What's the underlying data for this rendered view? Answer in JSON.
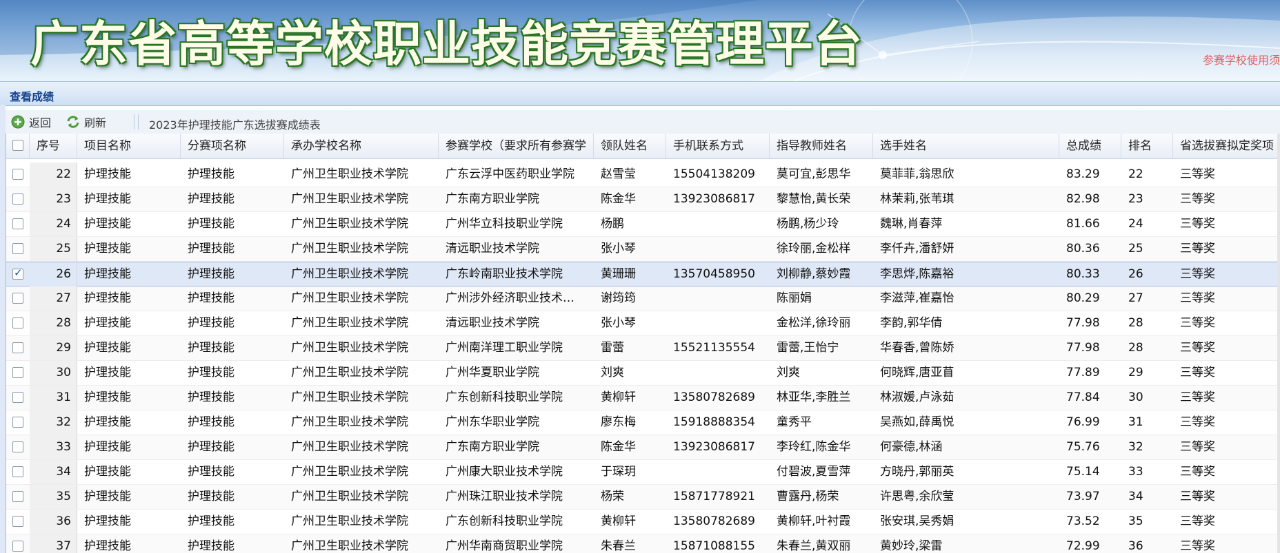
{
  "banner": {
    "title": "广东省高等学校职业技能竞赛管理平台",
    "note": "参赛学校使用须"
  },
  "panel": {
    "title": "查看成绩"
  },
  "toolbar": {
    "back_label": "返回",
    "refresh_label": "刷新",
    "sheet_title": "2023年护理技能广东选拔赛成绩表",
    "icons": {
      "back": "add-circle-icon",
      "refresh": "refresh-icon"
    }
  },
  "columns": [
    "序号",
    "项目名称",
    "分赛项名称",
    "承办学校名称",
    "参赛学校（要求所有参赛学",
    "领队姓名",
    "手机联系方式",
    "指导教师姓名",
    "选手姓名",
    "总成绩",
    "排名",
    "省选拔赛拟定奖项"
  ],
  "rows": [
    {
      "no": "22",
      "project": "护理技能",
      "sub": "护理技能",
      "host": "广州卫生职业技术学院",
      "school": "广东云浮中医药职业学院",
      "leader": "赵雪莹",
      "phone": "15504138209",
      "teachers": "莫可宜,彭思华",
      "players": "莫菲菲,翁思欣",
      "score": "83.29",
      "rank": "22",
      "award": "三等奖",
      "checked": false
    },
    {
      "no": "23",
      "project": "护理技能",
      "sub": "护理技能",
      "host": "广州卫生职业技术学院",
      "school": "广东南方职业学院",
      "leader": "陈金华",
      "phone": "13923086817",
      "teachers": "黎慧怡,黄长荣",
      "players": "林茉莉,张苇琪",
      "score": "82.98",
      "rank": "23",
      "award": "三等奖",
      "checked": false
    },
    {
      "no": "24",
      "project": "护理技能",
      "sub": "护理技能",
      "host": "广州卫生职业技术学院",
      "school": "广州华立科技职业学院",
      "leader": "杨鹏",
      "phone": "",
      "teachers": "杨鹏,杨少玲",
      "players": "魏琳,肖春萍",
      "score": "81.66",
      "rank": "24",
      "award": "三等奖",
      "checked": false
    },
    {
      "no": "25",
      "project": "护理技能",
      "sub": "护理技能",
      "host": "广州卫生职业技术学院",
      "school": "清远职业技术学院",
      "leader": "张小琴",
      "phone": "",
      "teachers": "徐玲丽,金松样",
      "players": "李仟卉,潘舒妍",
      "score": "80.36",
      "rank": "25",
      "award": "三等奖",
      "checked": false
    },
    {
      "no": "26",
      "project": "护理技能",
      "sub": "护理技能",
      "host": "广州卫生职业技术学院",
      "school": "广东岭南职业技术学院",
      "leader": "黄珊珊",
      "phone": "13570458950",
      "teachers": "刘柳静,蔡妙霞",
      "players": "李思烨,陈嘉裕",
      "score": "80.33",
      "rank": "26",
      "award": "三等奖",
      "checked": true
    },
    {
      "no": "27",
      "project": "护理技能",
      "sub": "护理技能",
      "host": "广州卫生职业技术学院",
      "school": "广州涉外经济职业技术…",
      "leader": "谢筠筠",
      "phone": "",
      "teachers": "陈丽娟",
      "players": "李滋萍,崔嘉怡",
      "score": "80.29",
      "rank": "27",
      "award": "三等奖",
      "checked": false
    },
    {
      "no": "28",
      "project": "护理技能",
      "sub": "护理技能",
      "host": "广州卫生职业技术学院",
      "school": "清远职业技术学院",
      "leader": "张小琴",
      "phone": "",
      "teachers": "金松洋,徐玲丽",
      "players": "李韵,郭华倩",
      "score": "77.98",
      "rank": "28",
      "award": "三等奖",
      "checked": false
    },
    {
      "no": "29",
      "project": "护理技能",
      "sub": "护理技能",
      "host": "广州卫生职业技术学院",
      "school": "广州南洋理工职业学院",
      "leader": "雷蕾",
      "phone": "15521135554",
      "teachers": "雷蕾,王怡宁",
      "players": "华春香,曾陈娇",
      "score": "77.98",
      "rank": "28",
      "award": "三等奖",
      "checked": false
    },
    {
      "no": "30",
      "project": "护理技能",
      "sub": "护理技能",
      "host": "广州卫生职业技术学院",
      "school": "广州华夏职业学院",
      "leader": "刘爽",
      "phone": "",
      "teachers": "刘爽",
      "players": "何晓辉,唐亚苜",
      "score": "77.89",
      "rank": "29",
      "award": "三等奖",
      "checked": false
    },
    {
      "no": "31",
      "project": "护理技能",
      "sub": "护理技能",
      "host": "广州卫生职业技术学院",
      "school": "广东创新科技职业学院",
      "leader": "黄柳轩",
      "phone": "13580782689",
      "teachers": "林亚华,李胜兰",
      "players": "林淑媛,卢泳茹",
      "score": "77.84",
      "rank": "30",
      "award": "三等奖",
      "checked": false
    },
    {
      "no": "32",
      "project": "护理技能",
      "sub": "护理技能",
      "host": "广州卫生职业技术学院",
      "school": "广州东华职业学院",
      "leader": "廖东梅",
      "phone": "15918888354",
      "teachers": "童秀平",
      "players": "吴燕如,薛禹悦",
      "score": "76.99",
      "rank": "31",
      "award": "三等奖",
      "checked": false
    },
    {
      "no": "33",
      "project": "护理技能",
      "sub": "护理技能",
      "host": "广州卫生职业技术学院",
      "school": "广东南方职业学院",
      "leader": "陈金华",
      "phone": "13923086817",
      "teachers": "李玲红,陈金华",
      "players": "何豪德,林涵",
      "score": "75.76",
      "rank": "32",
      "award": "三等奖",
      "checked": false
    },
    {
      "no": "34",
      "project": "护理技能",
      "sub": "护理技能",
      "host": "广州卫生职业技术学院",
      "school": "广州康大职业技术学院",
      "leader": "于琛玥",
      "phone": "",
      "teachers": "付碧波,夏雪萍",
      "players": "方晓丹,郭丽英",
      "score": "75.14",
      "rank": "33",
      "award": "三等奖",
      "checked": false
    },
    {
      "no": "35",
      "project": "护理技能",
      "sub": "护理技能",
      "host": "广州卫生职业技术学院",
      "school": "广州珠江职业技术学院",
      "leader": "杨荣",
      "phone": "15871778921",
      "teachers": "曹露丹,杨荣",
      "players": "许思粤,余欣莹",
      "score": "73.97",
      "rank": "34",
      "award": "三等奖",
      "checked": false
    },
    {
      "no": "36",
      "project": "护理技能",
      "sub": "护理技能",
      "host": "广州卫生职业技术学院",
      "school": "广东创新科技职业学院",
      "leader": "黄柳轩",
      "phone": "13580782689",
      "teachers": "黄柳轩,叶衬霞",
      "players": "张安琪,吴秀娟",
      "score": "73.52",
      "rank": "35",
      "award": "三等奖",
      "checked": false
    },
    {
      "no": "37",
      "project": "护理技能",
      "sub": "护理技能",
      "host": "广州卫生职业技术学院",
      "school": "广州华南商贸职业学院",
      "leader": "朱春兰",
      "phone": "15871088155",
      "teachers": "朱春兰,黄双丽",
      "players": "黄妙玲,梁雷",
      "score": "72.99",
      "rank": "36",
      "award": "三等奖",
      "checked": false
    }
  ]
}
